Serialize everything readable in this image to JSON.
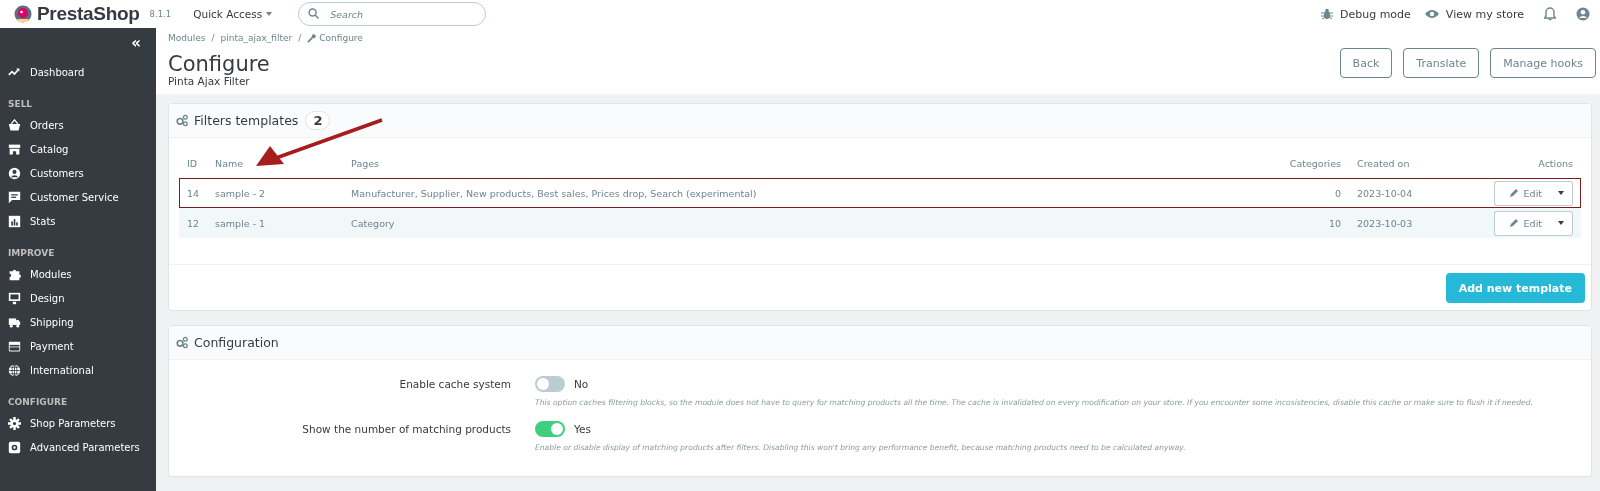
{
  "header": {
    "logo": "PrestaShop",
    "version": "8.1.1",
    "quick_access": "Quick Access",
    "search": {
      "placeholder": "Search"
    },
    "debug_mode": "Debug mode",
    "view_store": "View my store"
  },
  "sidebar": {
    "collapse": "«",
    "sections": [
      {
        "items": [
          {
            "label": "Dashboard"
          }
        ]
      },
      {
        "heading": "SELL",
        "items": [
          {
            "label": "Orders"
          },
          {
            "label": "Catalog"
          },
          {
            "label": "Customers"
          },
          {
            "label": "Customer Service"
          },
          {
            "label": "Stats"
          }
        ]
      },
      {
        "heading": "IMPROVE",
        "items": [
          {
            "label": "Modules"
          },
          {
            "label": "Design"
          },
          {
            "label": "Shipping"
          },
          {
            "label": "Payment"
          },
          {
            "label": "International"
          }
        ]
      },
      {
        "heading": "CONFIGURE",
        "items": [
          {
            "label": "Shop Parameters"
          },
          {
            "label": "Advanced Parameters"
          }
        ]
      }
    ]
  },
  "breadcrumb": {
    "items": [
      "Modules",
      "pinta_ajax_filter",
      "Configure"
    ],
    "separator": "/"
  },
  "page": {
    "title": "Configure",
    "subtitle": "Pinta Ajax Filter",
    "buttons": [
      "Back",
      "Translate",
      "Manage hooks"
    ]
  },
  "filters_panel": {
    "title": "Filters templates",
    "count": "2",
    "table": {
      "columns": [
        "ID",
        "Name",
        "Pages",
        "Categories",
        "Created on",
        "Actions"
      ],
      "rows": [
        {
          "id": "14",
          "name": "sample - 2",
          "pages": "Manufacturer, Supplier, New products, Best sales, Prices drop, Search (experimental)",
          "categories": "0",
          "created_on": "2023-10-04",
          "action": "Edit",
          "highlighted": true
        },
        {
          "id": "12",
          "name": "sample - 1",
          "pages": "Category",
          "categories": "10",
          "created_on": "2023-10-03",
          "action": "Edit",
          "highlighted": false
        }
      ]
    },
    "annotation_arrow": true,
    "add_button": "Add new template"
  },
  "config_panel": {
    "title": "Configuration",
    "settings": [
      {
        "label": "Enable cache system",
        "on": false,
        "state_label": "No",
        "help": "This option caches filtering blocks, so the module does not have to query for matching products all the time. The cache is invalidated on every modification on your store. If you encounter some incosistencies, disable this cache or make sure to flush it if needed."
      },
      {
        "label": "Show the number of matching products",
        "on": true,
        "state_label": "Yes",
        "help": "Enable or disable display of matching products after filters. Disabling this won't bring any performance benefit, because matching products need to be calculated anyway."
      }
    ]
  }
}
